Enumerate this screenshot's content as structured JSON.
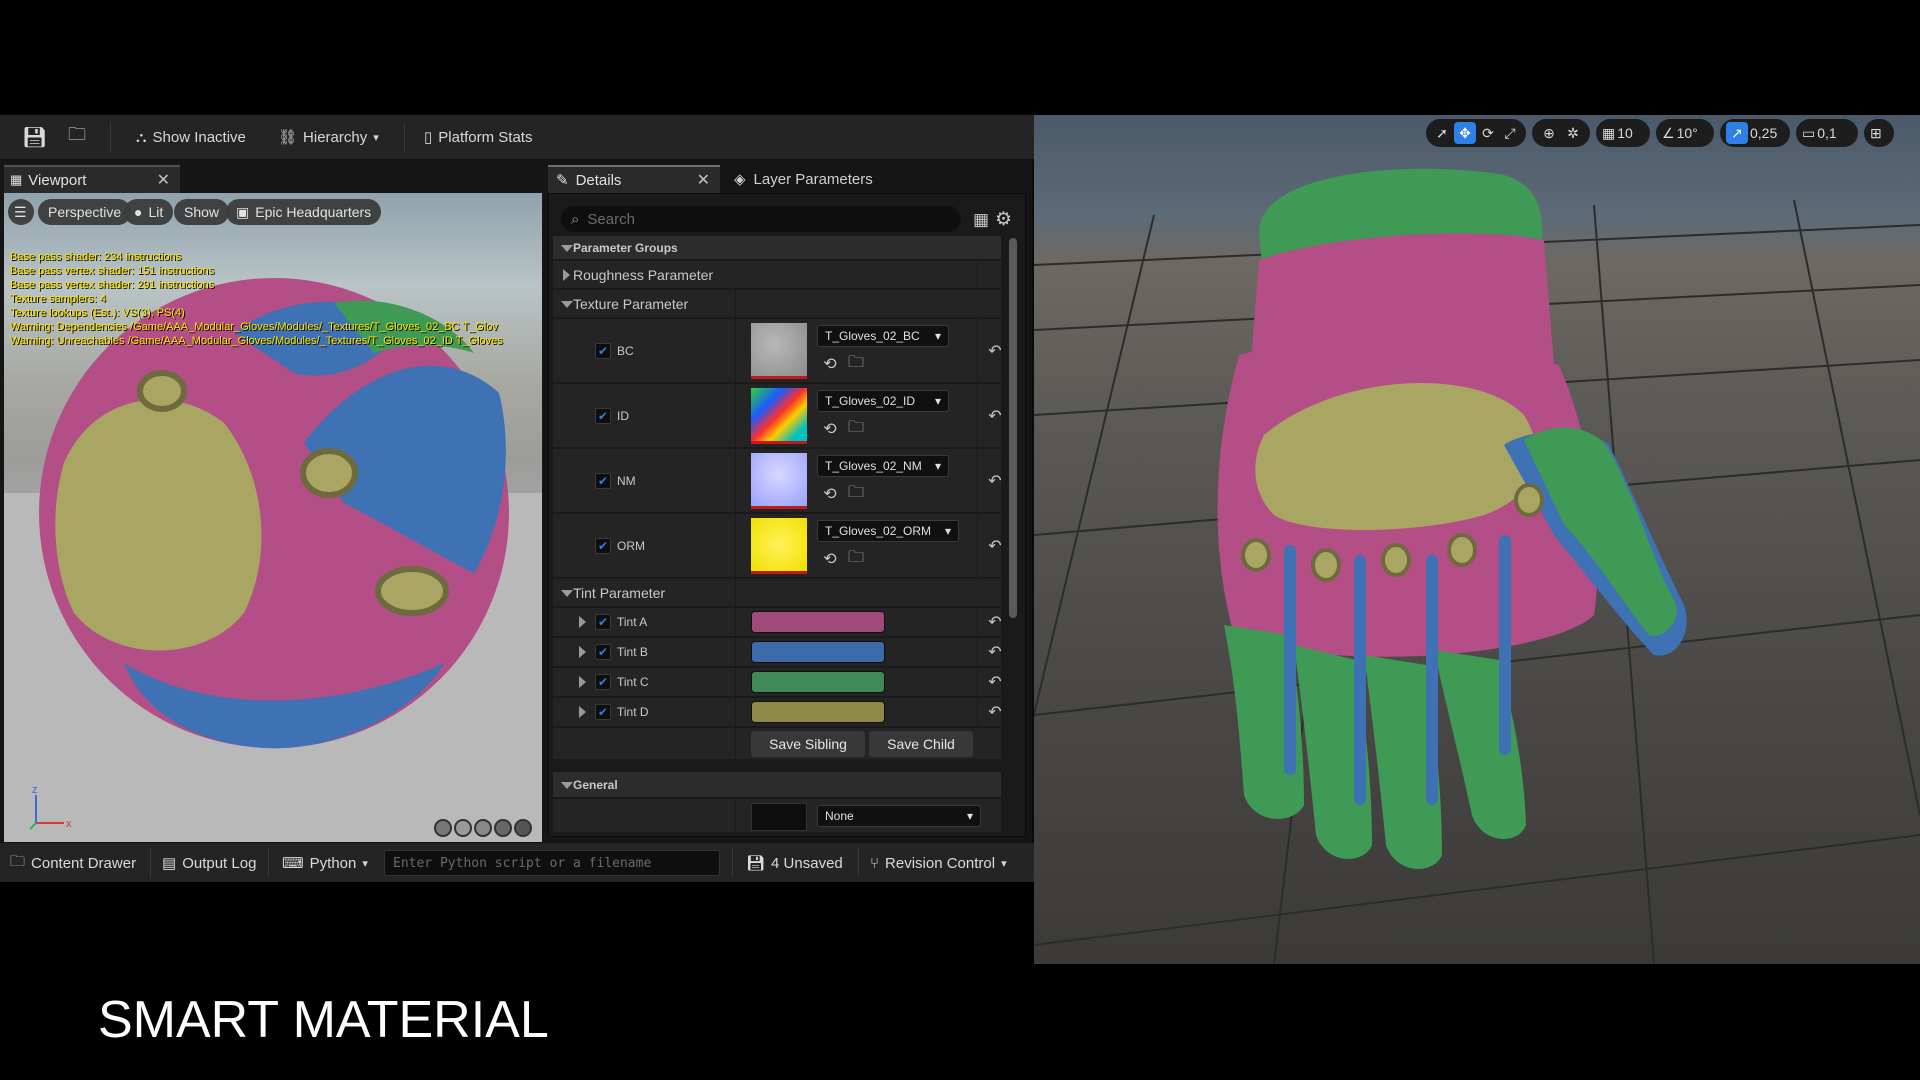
{
  "toolbar": {
    "show_inactive": "Show Inactive",
    "hierarchy": "Hierarchy",
    "platform_stats": "Platform Stats"
  },
  "viewport": {
    "tab_label": "Viewport",
    "perspective": "Perspective",
    "lit": "Lit",
    "show": "Show",
    "location": "Epic Headquarters",
    "stats": [
      "Base pass shader: 234 instructions",
      "Base pass vertex shader: 151 instructions",
      "Base pass vertex shader: 291 instructions",
      "Texture samplers: 4",
      "Texture lookups (Est.): VS(3), PS(4)",
      "Warning: Dependencies /Game/AAA_Modular_Gloves/Modules/_Textures/T_Gloves_02_BC T_Glov",
      "Warning: Unreachables /Game/AAA_Modular_Gloves/Modules/_Textures/T_Gloves_02_ID T_Gloves"
    ]
  },
  "details": {
    "tab_label": "Details",
    "layer_tab_label": "Layer Parameters",
    "search_placeholder": "Search",
    "parameter_groups": "Parameter Groups",
    "roughness_parameter": "Roughness Parameter",
    "texture_parameter": "Texture Parameter",
    "textures": [
      {
        "label": "BC",
        "asset": "T_Gloves_02_BC"
      },
      {
        "label": "ID",
        "asset": "T_Gloves_02_ID"
      },
      {
        "label": "NM",
        "asset": "T_Gloves_02_NM"
      },
      {
        "label": "ORM",
        "asset": "T_Gloves_02_ORM"
      }
    ],
    "tint_parameter": "Tint Parameter",
    "tints": [
      {
        "label": "Tint A",
        "color": "#a04a7a"
      },
      {
        "label": "Tint B",
        "color": "#3d6aab"
      },
      {
        "label": "Tint C",
        "color": "#3f8a55"
      },
      {
        "label": "Tint D",
        "color": "#8f8a4a"
      }
    ],
    "save_sibling": "Save Sibling",
    "save_child": "Save Child",
    "general": "General",
    "general_value": "None"
  },
  "statusbar": {
    "content_drawer": "Content Drawer",
    "output_log": "Output Log",
    "python": "Python",
    "python_placeholder": "Enter Python script or a filename",
    "unsaved": "4 Unsaved",
    "revision_control": "Revision Control"
  },
  "scene_toolbar": {
    "grid_snap": "10",
    "angle_snap": "10°",
    "scale_snap": "0,25",
    "camera_speed": "0,1"
  },
  "caption": "SMART MATERIAL",
  "colors": {
    "accent_blue": "#2f7fe6",
    "glove_pink": "#b44e86",
    "glove_green": "#3f9a55",
    "glove_blue": "#3e72b4",
    "glove_yellow": "#a9a563"
  }
}
